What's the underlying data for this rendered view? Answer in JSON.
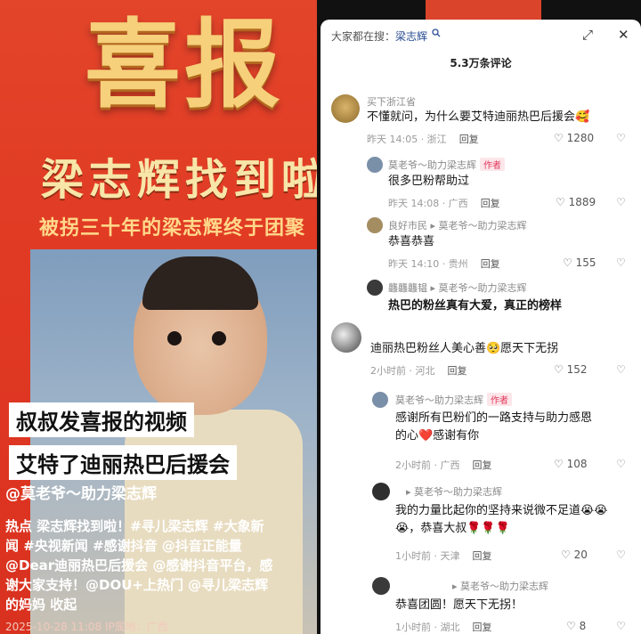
{
  "video": {
    "poster_title": "喜报",
    "poster_headline": "梁志辉找到啦",
    "poster_subtitle": "被拐三十年的梁志辉终于团聚",
    "caption_1": "叔叔发喜报的视频",
    "caption_2": "艾特了迪丽热巴后援会",
    "author": "@莫老爷～助力梁志辉",
    "desc_lines": [
      "热点 梁志辉找到啦！#寻儿梁志辉 #大象新",
      "闻 #央视新闻 #感谢抖音 @抖音正能量",
      "@Dear迪丽热巴后援会 @感谢抖音平台，感",
      "谢大家支持！@DOU+上热门 @寻儿梁志辉",
      "的妈妈  收起"
    ],
    "meta": "2025-10-28 11:08  IP属地：广西"
  },
  "panel": {
    "search_prefix": "大家都在搜：",
    "search_query": "梁志辉",
    "search_icon": "search-icon",
    "count_title": "5.3万条评论",
    "comments": [
      {
        "name": "买下浙江省",
        "text": "不懂就问，为什么要艾特迪丽热巴后援会🥰",
        "time": "昨天 14:05 · 浙江",
        "reply": "回复",
        "likes": "1280"
      },
      {
        "name": "莫老爷～助力梁志辉",
        "tag": "作者",
        "text": "很多巴粉帮助过",
        "time": "昨天 14:08 · 广西",
        "reply": "回复",
        "likes": "1889"
      },
      {
        "name": "良好市民 ▸ 莫老爷～助力梁志辉",
        "text": "恭喜恭喜",
        "time": "昨天 14:10 · 贵州",
        "reply": "回复",
        "likes": "155"
      },
      {
        "name": "龘龘龘韫 ▸ 莫老爷～助力梁志辉",
        "text": "热巴的粉丝真有大爱，真正的榜样",
        "time": "",
        "reply": "",
        "likes": ""
      },
      {
        "name": "",
        "text": "迪丽热巴粉丝人美心善🥺愿天下无拐",
        "time": "2小时前 · 河北",
        "reply": "回复",
        "likes": "152"
      },
      {
        "name": "莫老爷～助力梁志辉",
        "tag": "作者",
        "text": "感谢所有巴粉们的一路支持与助力感恩的心❤️感谢有你",
        "time": "2小时前 · 广西",
        "reply": "回复",
        "likes": "108"
      },
      {
        "name": "▸ 莫老爷～助力梁志辉",
        "text": "我的力量比起你的坚持来说微不足道😭😭😭，恭喜大叔🌹🌹🌹",
        "time": "1小时前 · 天津",
        "reply": "回复",
        "likes": "20"
      },
      {
        "name": "▸ 莫老爷～助力梁志辉",
        "text": "恭喜团圆！愿天下无拐！",
        "time": "1小时前 · 湖北",
        "reply": "回复",
        "likes": "8"
      }
    ]
  },
  "colors": {
    "poster_red": "#e13a24",
    "gold": "#f6d07a",
    "link": "#2a4d93",
    "author_tag": "#e2365a"
  }
}
